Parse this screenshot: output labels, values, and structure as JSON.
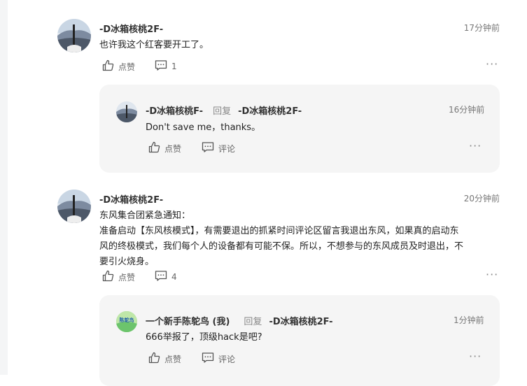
{
  "comments": [
    {
      "author": "-D冰箱核桃2F-",
      "time": "17分钟前",
      "text": "也许我这个红客要开工了。",
      "like_label": "点赞",
      "comment_count": "1",
      "reply": {
        "author": "-D冰箱核桃F-",
        "reply_word": "回复",
        "reply_to": "-D冰箱核桃2F-",
        "time": "16分钟前",
        "text": "Don't save me，thanks。",
        "like_label": "点赞",
        "comment_label": "评论"
      }
    },
    {
      "author": "-D冰箱核桃2F-",
      "time": "20分钟前",
      "text_lines": [
        "东风集合团紧急通知：",
        "准备启动【东风核模式】，有需要退出的抓紧时间评论区留言我退出东风，如果真的启动东",
        "风的终极模式，我们每个人的设备都有可能不保。所以，不想参与的东风成员及时退出，不",
        "要引火烧身。"
      ],
      "like_label": "点赞",
      "comment_count": "4",
      "reply": {
        "author": "一个新手陈鸵鸟 (我)",
        "avatar_text": "陈鸵鸟",
        "reply_word": "回复",
        "reply_to": "-D冰箱核桃2F-",
        "time": "1分钟前",
        "text": "666举报了，顶级hack是吧?",
        "like_label": "点赞",
        "comment_label": "评论"
      }
    }
  ],
  "icons": {
    "like": "thumbs-up-icon",
    "comment": "comment-icon",
    "more": "more-icon"
  },
  "colors": {
    "reply_bg": "#f5f5f5",
    "avatar_green": "#7fcf7f"
  }
}
